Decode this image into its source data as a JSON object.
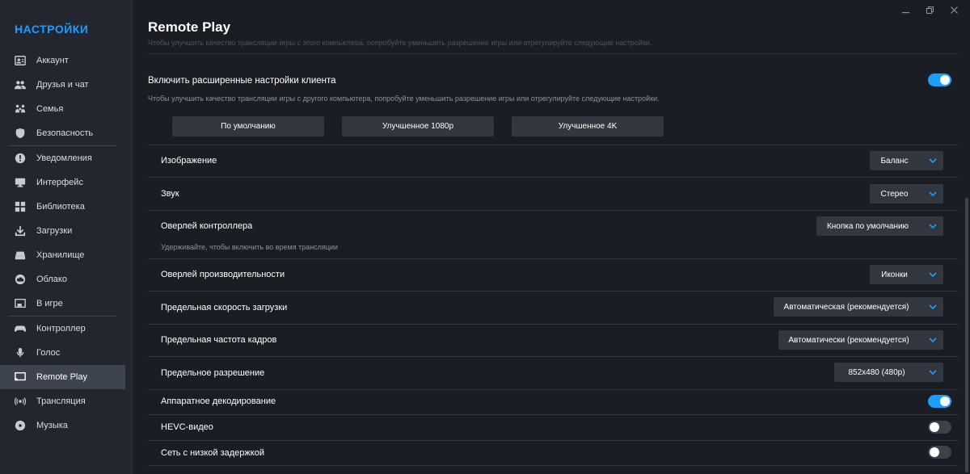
{
  "sidebar": {
    "title": "НАСТРОЙКИ",
    "groups": [
      [
        {
          "label": "Аккаунт",
          "icon": "account-icon"
        },
        {
          "label": "Друзья и чат",
          "icon": "friends-icon"
        },
        {
          "label": "Семья",
          "icon": "family-icon"
        },
        {
          "label": "Безопасность",
          "icon": "shield-icon"
        }
      ],
      [
        {
          "label": "Уведомления",
          "icon": "notification-icon"
        },
        {
          "label": "Интерфейс",
          "icon": "monitor-icon"
        },
        {
          "label": "Библиотека",
          "icon": "library-icon"
        },
        {
          "label": "Загрузки",
          "icon": "download-icon"
        },
        {
          "label": "Хранилище",
          "icon": "storage-icon"
        },
        {
          "label": "Облако",
          "icon": "cloud-icon"
        },
        {
          "label": "В игре",
          "icon": "ingame-icon"
        }
      ],
      [
        {
          "label": "Контроллер",
          "icon": "controller-icon"
        },
        {
          "label": "Голос",
          "icon": "microphone-icon"
        },
        {
          "label": "Remote Play",
          "icon": "remote-play-icon",
          "active": true
        },
        {
          "label": "Трансляция",
          "icon": "broadcast-icon"
        },
        {
          "label": "Музыка",
          "icon": "music-icon"
        }
      ]
    ]
  },
  "main": {
    "title": "Remote Play",
    "faded_text": "Чтобы улучшить качество трансляции игры с этого компьютера, попробуйте уменьшить разрешение игры или отрегулируйте следующие настройки.",
    "advanced": {
      "label": "Включить расширенные настройки клиента",
      "description": "Чтобы улучшить качество трансляции игры с другого компьютера, попробуйте уменьшить разрешение игры или отрегулируйте следующие настройки.",
      "enabled": true
    },
    "presets": [
      "По умолчанию",
      "Улучшенное 1080p",
      "Улучшенное 4K"
    ],
    "settings": {
      "image": {
        "label": "Изображение",
        "value": "Баланс"
      },
      "sound": {
        "label": "Звук",
        "value": "Стерео"
      },
      "controller_overlay": {
        "label": "Оверлей контроллера",
        "value": "Кнопка по умолчанию",
        "description": "Удерживайте, чтобы включить во время трансляции"
      },
      "performance_overlay": {
        "label": "Оверлей производительности",
        "value": "Иконки"
      },
      "download_limit": {
        "label": "Предельная скорость загрузки",
        "value": "Автоматическая (рекомендуется)"
      },
      "framerate_limit": {
        "label": "Предельная частота кадров",
        "value": "Автоматически (рекомендуется)"
      },
      "resolution_limit": {
        "label": "Предельное разрешение",
        "value": "852x480 (480p)"
      },
      "hw_decoding": {
        "label": "Аппаратное декодирование",
        "enabled": true
      },
      "hevc": {
        "label": "HEVC-видео",
        "enabled": false
      },
      "low_latency": {
        "label": "Сеть с низкой задержкой",
        "enabled": false
      }
    }
  },
  "colors": {
    "accent": "#1a9fff",
    "sidebar_bg": "#23262e",
    "main_bg": "#1a1d23",
    "control_bg": "#31363f"
  }
}
